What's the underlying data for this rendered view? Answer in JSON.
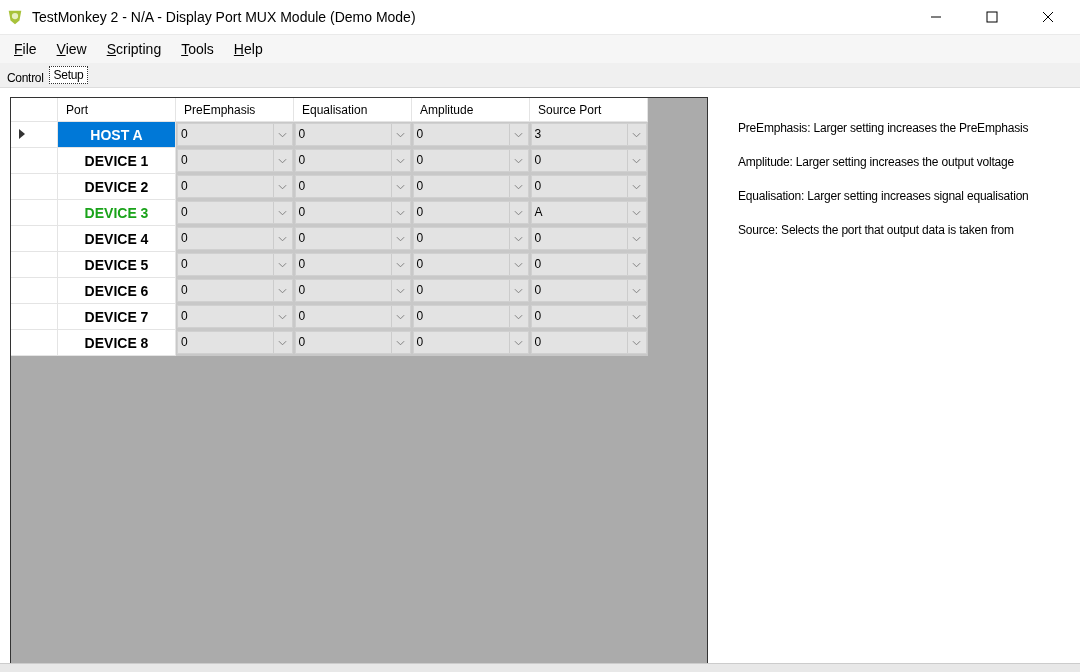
{
  "window": {
    "title": "TestMonkey 2 - N/A - Display Port MUX Module (Demo Mode)"
  },
  "menu": [
    "File",
    "View",
    "Scripting",
    "Tools",
    "Help"
  ],
  "tabs": [
    {
      "label": "Control",
      "selected": false
    },
    {
      "label": "Setup",
      "selected": true
    }
  ],
  "table": {
    "columns": [
      "Port",
      "PreEmphasis",
      "Equalisation",
      "Amplitude",
      "Source Port"
    ],
    "rows": [
      {
        "port": "HOST A",
        "selected": true,
        "values": [
          "0",
          "0",
          "0",
          "3"
        ]
      },
      {
        "port": "DEVICE 1",
        "selected": false,
        "color": "#000000",
        "values": [
          "0",
          "0",
          "0",
          "0"
        ]
      },
      {
        "port": "DEVICE 2",
        "selected": false,
        "color": "#000000",
        "values": [
          "0",
          "0",
          "0",
          "0"
        ]
      },
      {
        "port": "DEVICE 3",
        "selected": false,
        "color": "#1aa31a",
        "values": [
          "0",
          "0",
          "0",
          "A"
        ]
      },
      {
        "port": "DEVICE 4",
        "selected": false,
        "color": "#000000",
        "values": [
          "0",
          "0",
          "0",
          "0"
        ]
      },
      {
        "port": "DEVICE 5",
        "selected": false,
        "color": "#000000",
        "values": [
          "0",
          "0",
          "0",
          "0"
        ]
      },
      {
        "port": "DEVICE 6",
        "selected": false,
        "color": "#000000",
        "values": [
          "0",
          "0",
          "0",
          "0"
        ]
      },
      {
        "port": "DEVICE 7",
        "selected": false,
        "color": "#000000",
        "values": [
          "0",
          "0",
          "0",
          "0"
        ]
      },
      {
        "port": "DEVICE 8",
        "selected": false,
        "color": "#000000",
        "values": [
          "0",
          "0",
          "0",
          "0"
        ]
      }
    ]
  },
  "help": [
    "PreEmphasis: Larger setting increases the PreEmphasis",
    "Amplitude: Larger setting increases the output voltage",
    "Equalisation: Larger setting increases signal equalisation",
    "Source: Selects the port that output data is taken from"
  ]
}
